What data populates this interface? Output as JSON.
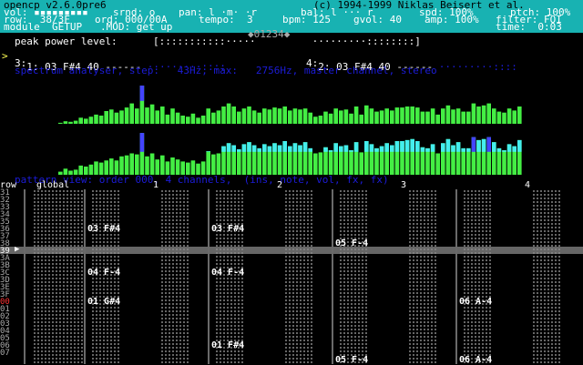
{
  "app": {
    "title": "opencp v2.6.0pre6",
    "copyright": "(c) 1994-1999 Niklas Beisert et al."
  },
  "status": {
    "vol": "vol: ▪▪▪▪▪▪▪▪▪",
    "srnd": "srnd: o",
    "pan": "pan: l ·m· ·r",
    "bal": "bal: l ··· r",
    "spd": "spd: 100%",
    "ptch": "ptch: 100%",
    "row": "row:  38/3F",
    "ord": "ord: 000/00A",
    "tempo": "tempo:  3",
    "bpm": "bpm: 125",
    "gvol": "gvol: 40",
    "amp": "amp: 100%",
    "filter": "filter: FOI",
    "module": "module  GETUP   .MOD: get up",
    "time": "time:  0:03"
  },
  "peak": {
    "label": "peak power level:",
    "left_meter": "[:::::::::::····· ",
    "right_meter": " ·········::::::::]",
    "mid": "◆01234◆"
  },
  "channels": [
    {
      "id": "1:",
      "note": "03 F#4 40",
      "fx": "------",
      "meter": "·········::::"
    },
    {
      "id": "2:",
      "note": "03 F#4 40",
      "fx": "------",
      "meter": "·········::::"
    },
    {
      "id": "3:",
      "note": "",
      "fx": "",
      "meter": ""
    },
    {
      "id": "4:",
      "note": "",
      "fx": "",
      "meter": ""
    }
  ],
  "spectrum": {
    "label": "spectrum analyser, step:   43Hz, max:   2756Hz, master channel, stereo",
    "top_values": [
      0.02,
      0.05,
      0.04,
      0.06,
      0.12,
      0.1,
      0.14,
      0.18,
      0.16,
      0.25,
      0.28,
      0.22,
      0.26,
      0.32,
      0.4,
      0.3,
      0.75,
      0.32,
      0.38,
      0.26,
      0.34,
      0.18,
      0.3,
      0.22,
      0.16,
      0.14,
      0.2,
      0.12,
      0.16,
      0.3,
      0.22,
      0.26,
      0.34,
      0.4,
      0.34,
      0.24,
      0.3,
      0.34,
      0.26,
      0.22,
      0.3,
      0.28,
      0.32,
      0.3,
      0.34,
      0.26,
      0.3,
      0.28,
      0.3,
      0.22,
      0.14,
      0.16,
      0.24,
      0.2,
      0.3,
      0.26,
      0.28,
      0.2,
      0.34,
      0.18,
      0.36,
      0.3,
      0.24,
      0.26,
      0.3,
      0.26,
      0.32,
      0.32,
      0.34,
      0.34,
      0.32,
      0.24,
      0.24,
      0.3,
      0.18,
      0.3,
      0.36,
      0.28,
      0.3,
      0.24,
      0.24,
      0.4,
      0.34,
      0.36,
      0.4,
      0.3,
      0.24,
      0.22,
      0.3,
      0.26,
      0.34
    ],
    "bottom_values": [
      0.06,
      0.12,
      0.08,
      0.1,
      0.18,
      0.16,
      0.2,
      0.26,
      0.24,
      0.28,
      0.32,
      0.28,
      0.36,
      0.38,
      0.42,
      0.4,
      0.82,
      0.36,
      0.42,
      0.3,
      0.38,
      0.26,
      0.34,
      0.3,
      0.26,
      0.24,
      0.28,
      0.22,
      0.26,
      0.46,
      0.4,
      0.42,
      0.56,
      0.62,
      0.58,
      0.5,
      0.6,
      0.64,
      0.58,
      0.52,
      0.6,
      0.56,
      0.62,
      0.58,
      0.66,
      0.56,
      0.62,
      0.58,
      0.64,
      0.52,
      0.42,
      0.44,
      0.54,
      0.48,
      0.62,
      0.56,
      0.58,
      0.48,
      0.64,
      0.44,
      0.66,
      0.6,
      0.52,
      0.56,
      0.62,
      0.58,
      0.66,
      0.66,
      0.68,
      0.7,
      0.66,
      0.54,
      0.52,
      0.6,
      0.42,
      0.62,
      0.7,
      0.58,
      0.64,
      0.52,
      0.52,
      0.74,
      0.68,
      0.7,
      0.74,
      0.64,
      0.52,
      0.48,
      0.6,
      0.56,
      0.68
    ],
    "colors": {
      "green": "#44ee44",
      "cyan": "#44eeee",
      "blue": "#4444ff"
    }
  },
  "pattern": {
    "label": "pattern view: order 000, 4 channels,  (ins, note, vol, fx, fx)",
    "header": {
      "row": "row",
      "global": "global",
      "c1": "1",
      "c2": "2",
      "c3": "3",
      "c4": "4"
    },
    "rows": [
      "31",
      "32",
      "33",
      "34",
      "35",
      "36",
      "37",
      "38",
      "39",
      "3A",
      "3B",
      "3C",
      "3D",
      "3E",
      "3F",
      "00",
      "01",
      "02",
      "03",
      "04",
      "05",
      "06",
      "07"
    ],
    "notes": [
      {
        "row": 5,
        "ch": 1,
        "text": "03 F#4"
      },
      {
        "row": 5,
        "ch": 2,
        "text": "03 F#4"
      },
      {
        "row": 7,
        "ch": 3,
        "text": "05 F-4"
      },
      {
        "row": 11,
        "ch": 1,
        "text": "04 F-4"
      },
      {
        "row": 11,
        "ch": 2,
        "text": "04 F-4"
      },
      {
        "row": 15,
        "ch": 1,
        "text": "01 G#4"
      },
      {
        "row": 15,
        "ch": 4,
        "text": "06 A-4"
      },
      {
        "row": 21,
        "ch": 2,
        "text": "01 F#4"
      },
      {
        "row": 23,
        "ch": 3,
        "text": "05 F-4"
      },
      {
        "row": 23,
        "ch": 4,
        "text": "06 A-4"
      }
    ],
    "cursor_row_label": "39"
  }
}
